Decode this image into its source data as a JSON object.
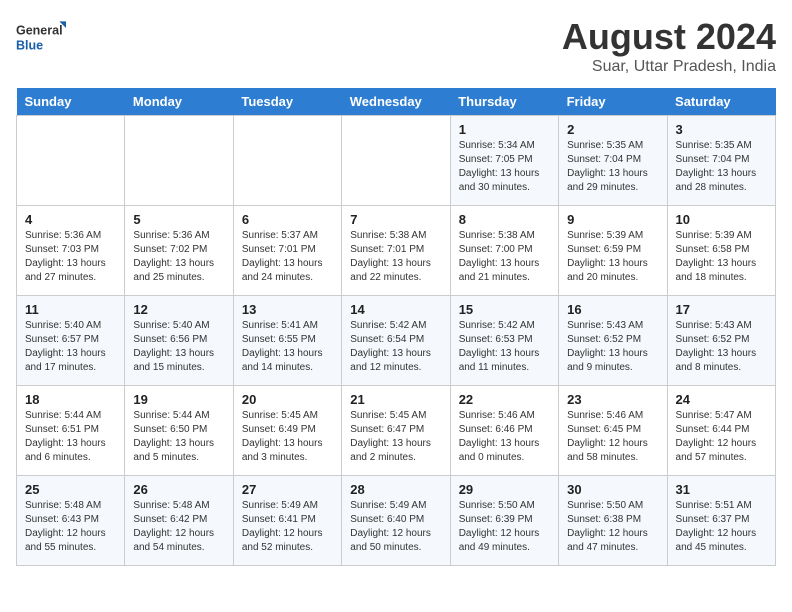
{
  "logo": {
    "line1": "General",
    "line2": "Blue"
  },
  "title": "August 2024",
  "subtitle": "Suar, Uttar Pradesh, India",
  "days_of_week": [
    "Sunday",
    "Monday",
    "Tuesday",
    "Wednesday",
    "Thursday",
    "Friday",
    "Saturday"
  ],
  "weeks": [
    [
      {
        "day": "",
        "info": ""
      },
      {
        "day": "",
        "info": ""
      },
      {
        "day": "",
        "info": ""
      },
      {
        "day": "",
        "info": ""
      },
      {
        "day": "1",
        "info": "Sunrise: 5:34 AM\nSunset: 7:05 PM\nDaylight: 13 hours and 30 minutes."
      },
      {
        "day": "2",
        "info": "Sunrise: 5:35 AM\nSunset: 7:04 PM\nDaylight: 13 hours and 29 minutes."
      },
      {
        "day": "3",
        "info": "Sunrise: 5:35 AM\nSunset: 7:04 PM\nDaylight: 13 hours and 28 minutes."
      }
    ],
    [
      {
        "day": "4",
        "info": "Sunrise: 5:36 AM\nSunset: 7:03 PM\nDaylight: 13 hours and 27 minutes."
      },
      {
        "day": "5",
        "info": "Sunrise: 5:36 AM\nSunset: 7:02 PM\nDaylight: 13 hours and 25 minutes."
      },
      {
        "day": "6",
        "info": "Sunrise: 5:37 AM\nSunset: 7:01 PM\nDaylight: 13 hours and 24 minutes."
      },
      {
        "day": "7",
        "info": "Sunrise: 5:38 AM\nSunset: 7:01 PM\nDaylight: 13 hours and 22 minutes."
      },
      {
        "day": "8",
        "info": "Sunrise: 5:38 AM\nSunset: 7:00 PM\nDaylight: 13 hours and 21 minutes."
      },
      {
        "day": "9",
        "info": "Sunrise: 5:39 AM\nSunset: 6:59 PM\nDaylight: 13 hours and 20 minutes."
      },
      {
        "day": "10",
        "info": "Sunrise: 5:39 AM\nSunset: 6:58 PM\nDaylight: 13 hours and 18 minutes."
      }
    ],
    [
      {
        "day": "11",
        "info": "Sunrise: 5:40 AM\nSunset: 6:57 PM\nDaylight: 13 hours and 17 minutes."
      },
      {
        "day": "12",
        "info": "Sunrise: 5:40 AM\nSunset: 6:56 PM\nDaylight: 13 hours and 15 minutes."
      },
      {
        "day": "13",
        "info": "Sunrise: 5:41 AM\nSunset: 6:55 PM\nDaylight: 13 hours and 14 minutes."
      },
      {
        "day": "14",
        "info": "Sunrise: 5:42 AM\nSunset: 6:54 PM\nDaylight: 13 hours and 12 minutes."
      },
      {
        "day": "15",
        "info": "Sunrise: 5:42 AM\nSunset: 6:53 PM\nDaylight: 13 hours and 11 minutes."
      },
      {
        "day": "16",
        "info": "Sunrise: 5:43 AM\nSunset: 6:52 PM\nDaylight: 13 hours and 9 minutes."
      },
      {
        "day": "17",
        "info": "Sunrise: 5:43 AM\nSunset: 6:52 PM\nDaylight: 13 hours and 8 minutes."
      }
    ],
    [
      {
        "day": "18",
        "info": "Sunrise: 5:44 AM\nSunset: 6:51 PM\nDaylight: 13 hours and 6 minutes."
      },
      {
        "day": "19",
        "info": "Sunrise: 5:44 AM\nSunset: 6:50 PM\nDaylight: 13 hours and 5 minutes."
      },
      {
        "day": "20",
        "info": "Sunrise: 5:45 AM\nSunset: 6:49 PM\nDaylight: 13 hours and 3 minutes."
      },
      {
        "day": "21",
        "info": "Sunrise: 5:45 AM\nSunset: 6:47 PM\nDaylight: 13 hours and 2 minutes."
      },
      {
        "day": "22",
        "info": "Sunrise: 5:46 AM\nSunset: 6:46 PM\nDaylight: 13 hours and 0 minutes."
      },
      {
        "day": "23",
        "info": "Sunrise: 5:46 AM\nSunset: 6:45 PM\nDaylight: 12 hours and 58 minutes."
      },
      {
        "day": "24",
        "info": "Sunrise: 5:47 AM\nSunset: 6:44 PM\nDaylight: 12 hours and 57 minutes."
      }
    ],
    [
      {
        "day": "25",
        "info": "Sunrise: 5:48 AM\nSunset: 6:43 PM\nDaylight: 12 hours and 55 minutes."
      },
      {
        "day": "26",
        "info": "Sunrise: 5:48 AM\nSunset: 6:42 PM\nDaylight: 12 hours and 54 minutes."
      },
      {
        "day": "27",
        "info": "Sunrise: 5:49 AM\nSunset: 6:41 PM\nDaylight: 12 hours and 52 minutes."
      },
      {
        "day": "28",
        "info": "Sunrise: 5:49 AM\nSunset: 6:40 PM\nDaylight: 12 hours and 50 minutes."
      },
      {
        "day": "29",
        "info": "Sunrise: 5:50 AM\nSunset: 6:39 PM\nDaylight: 12 hours and 49 minutes."
      },
      {
        "day": "30",
        "info": "Sunrise: 5:50 AM\nSunset: 6:38 PM\nDaylight: 12 hours and 47 minutes."
      },
      {
        "day": "31",
        "info": "Sunrise: 5:51 AM\nSunset: 6:37 PM\nDaylight: 12 hours and 45 minutes."
      }
    ]
  ]
}
